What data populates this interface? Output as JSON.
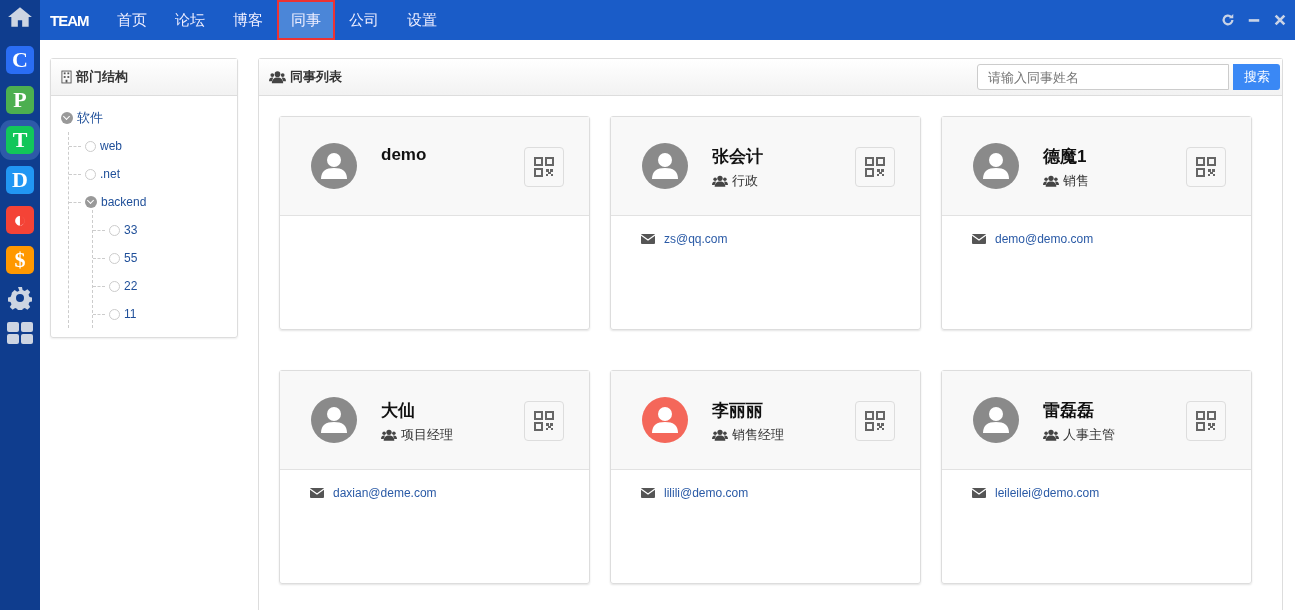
{
  "dock": [
    {
      "label": "C",
      "color": "#2a6df4",
      "selected": false
    },
    {
      "label": "P",
      "color": "#4caf50",
      "selected": false
    },
    {
      "label": "T",
      "color": "#12c65a",
      "selected": true
    },
    {
      "label": "D",
      "color": "#2196f3",
      "selected": false
    },
    {
      "label": "◐",
      "color": "#f44336",
      "selected": false
    },
    {
      "label": "$",
      "color": "#ff9800",
      "selected": false
    }
  ],
  "brand": "TEAM",
  "nav": [
    {
      "label": "首页",
      "selected": false
    },
    {
      "label": "论坛",
      "selected": false
    },
    {
      "label": "博客",
      "selected": false
    },
    {
      "label": "同事",
      "selected": true
    },
    {
      "label": "公司",
      "selected": false
    },
    {
      "label": "设置",
      "selected": false
    }
  ],
  "tree_panel": {
    "title": "部门结构",
    "nodes": [
      {
        "label": "软件",
        "expanded": true,
        "children": [
          {
            "label": "web"
          },
          {
            "label": ".net"
          },
          {
            "label": "backend",
            "expanded": true,
            "children": [
              {
                "label": "33"
              },
              {
                "label": "55"
              },
              {
                "label": "22"
              },
              {
                "label": "11"
              }
            ]
          }
        ]
      }
    ]
  },
  "list_panel": {
    "title": "同事列表",
    "search": {
      "placeholder": "请输入同事姓名",
      "button": "搜索"
    },
    "people": [
      {
        "name": "demo",
        "color": "#8a8a8a"
      },
      {
        "name": "张会计",
        "dept": "行政",
        "email": "zs@qq.com",
        "color": "#8a8a8a"
      },
      {
        "name": "德魔1",
        "dept": "销售",
        "email": "demo@demo.com",
        "color": "#8a8a8a"
      },
      {
        "name": "大仙",
        "dept": "项目经理",
        "email": "daxian@deme.com",
        "color": "#8a8a8a"
      },
      {
        "name": "李丽丽",
        "dept": "销售经理",
        "email": "lilili@demo.com",
        "color": "#f4675a"
      },
      {
        "name": "雷磊磊",
        "dept": "人事主管",
        "email": "leileilei@demo.com",
        "color": "#8a8a8a"
      }
    ]
  }
}
